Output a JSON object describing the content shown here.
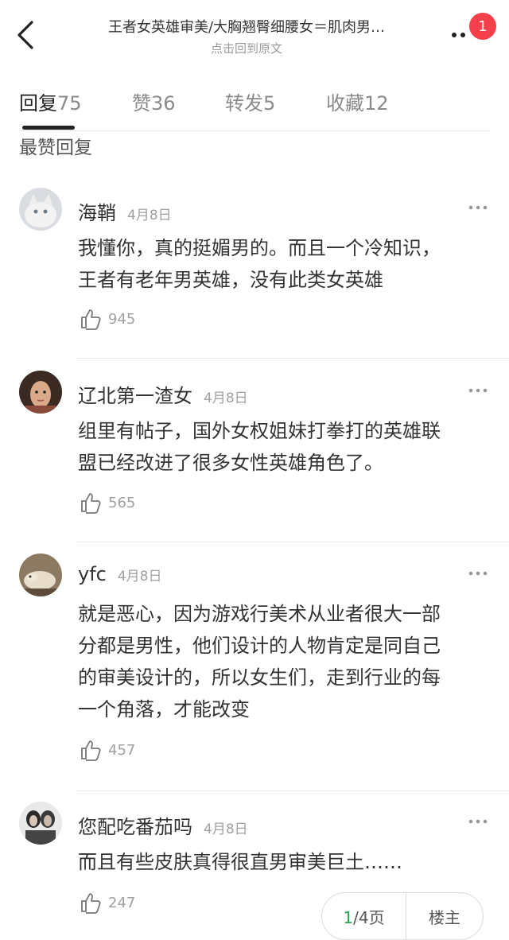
{
  "header": {
    "title": "王者女英雄审美/大胸翘臀细腰女＝肌肉男…",
    "subtitle": "点击回到原文",
    "badge": "1"
  },
  "tabs": [
    {
      "label": "回复",
      "count": "75"
    },
    {
      "label": "赞",
      "count": "36"
    },
    {
      "label": "转发",
      "count": "5"
    },
    {
      "label": "收藏",
      "count": "12"
    }
  ],
  "section_title": "最赞回复",
  "comments": [
    {
      "user": "海鞘",
      "date": "4月8日",
      "lines": [
        "我懂你，真的挺媚男的。而且一个冷知识，",
        "王者有老年男英雄，没有此类女英雄"
      ],
      "likes": "945"
    },
    {
      "user": "辽北第一渣女",
      "date": "4月8日",
      "lines": [
        "组里有帖子，国外女权姐妹打拳打的英雄联",
        "盟已经改进了很多女性英雄角色了。"
      ],
      "likes": "565"
    },
    {
      "user": "yfc",
      "date": "4月8日",
      "lines": [
        "就是恶心，因为游戏行美术从业者很大一部",
        "分都是男性，他们设计的人物肯定是同自己",
        "的审美设计的，所以女生们，走到行业的每",
        "一个角落，才能改变"
      ],
      "likes": "457"
    },
    {
      "user": "您配吃番茄吗",
      "date": "4月8日",
      "lines": [
        "而且有些皮肤真得很直男审美巨土……"
      ],
      "likes": "247"
    }
  ],
  "pager": {
    "current": "1",
    "total": "/4页",
    "owner_label": "楼主"
  },
  "colors": {
    "badge": "#f5404b",
    "pager_current": "#2ea44f",
    "text": "#333333",
    "muted": "#a0a0a0"
  }
}
